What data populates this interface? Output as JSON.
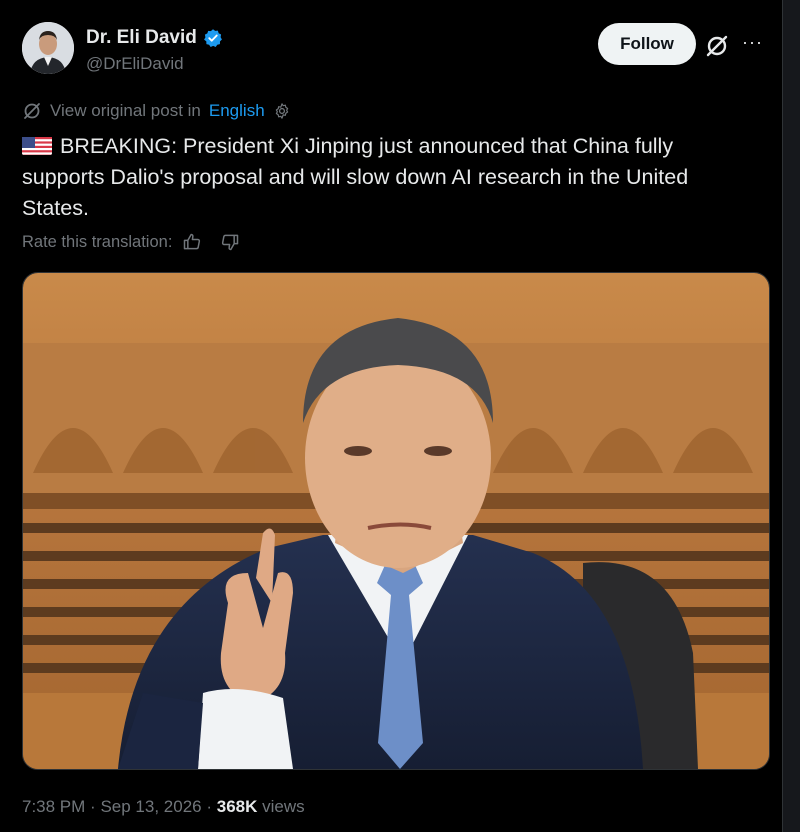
{
  "author": {
    "display_name": "Dr. Eli David",
    "handle": "@DrEliDavid",
    "verified": true
  },
  "header": {
    "follow_label": "Follow",
    "grok_icon": "slashed-circle-icon",
    "more_icon": "more-dots-icon"
  },
  "translation": {
    "prefix": "View original post in",
    "language": "English",
    "rate_label": "Rate this translation:"
  },
  "post": {
    "flag": "us-flag-emoji",
    "text": "BREAKING: President Xi Jinping just announced that China fully supports Dalio's proposal and will slow down AI research in the United States."
  },
  "media": {
    "type": "photo"
  },
  "meta": {
    "time": "7:38 PM",
    "separator": "·",
    "date": "Sep 13, 2026",
    "views_count": "368K",
    "views_label": "views"
  },
  "colors": {
    "background": "#000000",
    "text": "#e7e9ea",
    "muted": "#71767b",
    "link": "#1d9bf0",
    "verified": "#1d9bf0"
  }
}
